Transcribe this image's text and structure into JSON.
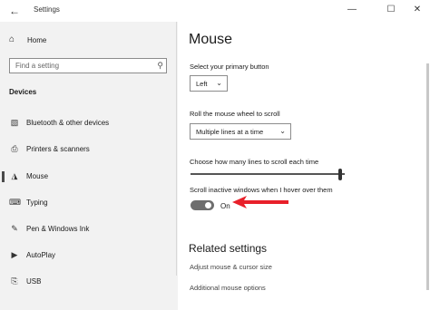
{
  "window": {
    "title": "Settings",
    "back_icon": "back-arrow-icon",
    "minimize_glyph": "—",
    "maximize_glyph": "☐",
    "close_glyph": "✕"
  },
  "sidebar": {
    "home_label": "Home",
    "search_placeholder": "Find a setting",
    "section_label": "Devices",
    "items": [
      {
        "label": "Bluetooth & other devices",
        "icon": "bluetooth-icon"
      },
      {
        "label": "Printers & scanners",
        "icon": "printer-icon"
      },
      {
        "label": "Mouse",
        "icon": "mouse-icon",
        "selected": true
      },
      {
        "label": "Typing",
        "icon": "keyboard-icon"
      },
      {
        "label": "Pen & Windows Ink",
        "icon": "pen-icon"
      },
      {
        "label": "AutoPlay",
        "icon": "autoplay-icon"
      },
      {
        "label": "USB",
        "icon": "usb-icon"
      }
    ]
  },
  "main": {
    "title": "Mouse",
    "primary_button": {
      "label": "Select your primary button",
      "value": "Left"
    },
    "scroll_wheel": {
      "label": "Roll the mouse wheel to scroll",
      "value": "Multiple lines at a time"
    },
    "lines_to_scroll": {
      "label": "Choose how many lines to scroll each time",
      "value_fraction": 0.97
    },
    "scroll_inactive": {
      "label": "Scroll inactive windows when I hover over them",
      "state": "On",
      "on": true
    },
    "annotation_arrow_color": "#e8202a",
    "related": {
      "title": "Related settings",
      "links": [
        "Adjust mouse & cursor size",
        "Additional mouse options"
      ]
    }
  }
}
